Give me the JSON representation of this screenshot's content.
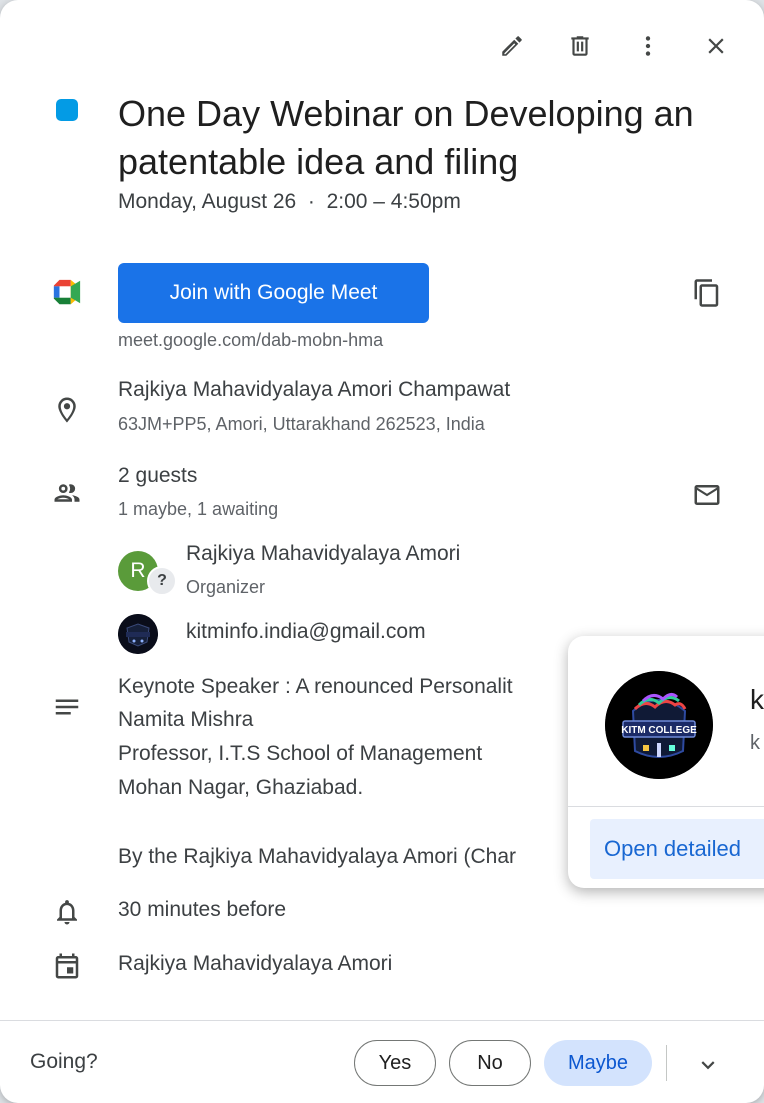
{
  "event": {
    "color": "#039be5",
    "title": "One Day Webinar on Developing an patentable idea and filing",
    "datetime": "Monday, August 26  ·  2:00 – 4:50pm"
  },
  "toolbar": {
    "edit_icon": "pencil-icon",
    "delete_icon": "trash-icon",
    "more_icon": "more-vert-icon",
    "close_icon": "close-icon"
  },
  "meet": {
    "join_label": "Join with Google Meet",
    "link": "meet.google.com/dab-mobn-hma"
  },
  "location": {
    "name": "Rajkiya Mahavidyalaya Amori Champawat",
    "address": "63JM+PP5, Amori, Uttarakhand 262523, India"
  },
  "guests": {
    "count": "2 guests",
    "rsvp_summary": "1 maybe, 1 awaiting",
    "list": [
      {
        "initial": "R",
        "name": "Rajkiya Mahavidyalaya Amori",
        "role": "Organizer",
        "badge": "?"
      },
      {
        "name": "kitminfo.india@gmail.com"
      }
    ]
  },
  "description": {
    "lines": [
      "Keynote Speaker : A renounced Personalit",
      "Namita Mishra",
      "Professor, I.T.S School of Management",
      "Mohan Nagar, Ghaziabad.",
      "By the Rajkiya Mahavidyalaya Amori (Char"
    ]
  },
  "reminder": "30 minutes before",
  "calendar": "Rajkiya Mahavidyalaya Amori",
  "footer": {
    "going_label": "Going?",
    "yes": "Yes",
    "no": "No",
    "maybe": "Maybe"
  },
  "popup": {
    "name": "k",
    "sub": "k",
    "logo_text": "KITM COLLEGE",
    "open_label": "Open detailed"
  }
}
